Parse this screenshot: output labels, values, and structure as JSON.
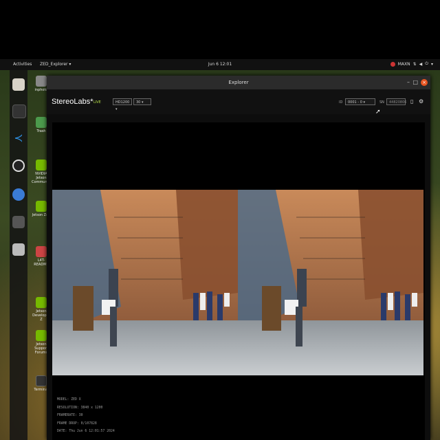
{
  "topbar": {
    "activities": "Activities",
    "app_menu": "ZED_Explorer ▾",
    "clock": "Jun 6 12:01",
    "power_mode": "MAXN"
  },
  "desktop_icons": [
    "inphoto",
    "Trash",
    "NVIDIA Jetson Community",
    "Jetson Zoo",
    "L4T-README",
    "Jetson Developer Z",
    "Jetson Support Forums",
    "Terminal"
  ],
  "window": {
    "title": "Explorer",
    "brand": "StereoLabs*",
    "live": "LIVE",
    "resolution_select": "HD1200",
    "fps_select": "30",
    "id_label": "ID",
    "id_select": "0001 - 0",
    "sn_label": "SN",
    "sn_value": "44820806"
  },
  "camera_info": {
    "model": "MODEL: ZED X",
    "resolution": "RESOLUTION: 3840 x 1200",
    "framerate": "FRAMERATE: 30",
    "frame_drop": "FRAME DROP: 0/107828",
    "date": "DATE: Thu Jun 6 12:01:57 2024"
  },
  "colors": {
    "accent": "#e95420",
    "live": "#b7e04a",
    "wall": "#8a4a2e"
  }
}
